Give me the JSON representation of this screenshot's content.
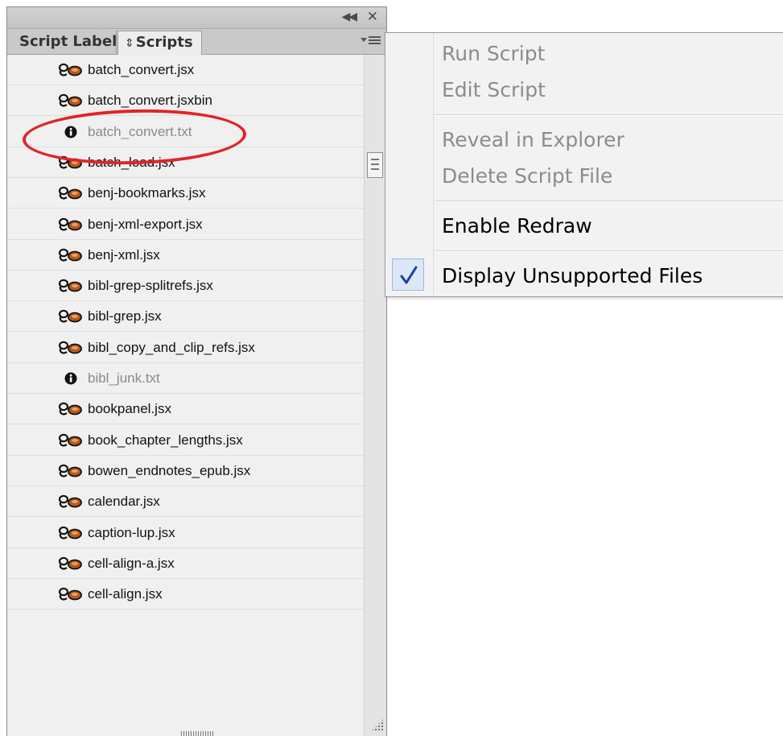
{
  "panel": {
    "collapse_icon": "double-chevron-left-icon",
    "close_icon": "close-icon",
    "tabs": [
      {
        "label": "Script Label",
        "active": false
      },
      {
        "label": "Scripts",
        "active": true
      }
    ],
    "menu_icon": "panel-menu-icon"
  },
  "files": [
    {
      "name": "batch_convert.jsx",
      "type": "script"
    },
    {
      "name": "batch_convert.jsxbin",
      "type": "script"
    },
    {
      "name": "batch_convert.txt",
      "type": "unsupported"
    },
    {
      "name": "batch_load.jsx",
      "type": "script"
    },
    {
      "name": "benj-bookmarks.jsx",
      "type": "script"
    },
    {
      "name": "benj-xml-export.jsx",
      "type": "script"
    },
    {
      "name": "benj-xml.jsx",
      "type": "script"
    },
    {
      "name": "bibl-grep-splitrefs.jsx",
      "type": "script"
    },
    {
      "name": "bibl-grep.jsx",
      "type": "script"
    },
    {
      "name": "bibl_copy_and_clip_refs.jsx",
      "type": "script"
    },
    {
      "name": "bibl_junk.txt",
      "type": "unsupported"
    },
    {
      "name": "bookpanel.jsx",
      "type": "script"
    },
    {
      "name": "book_chapter_lengths.jsx",
      "type": "script"
    },
    {
      "name": "bowen_endnotes_epub.jsx",
      "type": "script"
    },
    {
      "name": "calendar.jsx",
      "type": "script"
    },
    {
      "name": "caption-lup.jsx",
      "type": "script"
    },
    {
      "name": "cell-align-a.jsx",
      "type": "script"
    },
    {
      "name": "cell-align.jsx",
      "type": "script"
    }
  ],
  "context_menu": {
    "items": [
      {
        "label": "Run Script",
        "enabled": false
      },
      {
        "label": "Edit Script",
        "enabled": false
      },
      {
        "label": "Reveal in Explorer",
        "enabled": false
      },
      {
        "label": "Delete Script File",
        "enabled": false
      },
      {
        "label": "Enable Redraw",
        "enabled": true
      },
      {
        "label": "Display Unsupported Files",
        "enabled": true,
        "checked": true
      }
    ]
  },
  "colors": {
    "highlight_ellipse": "#e0242a",
    "checkmark": "#1f3f9a"
  }
}
